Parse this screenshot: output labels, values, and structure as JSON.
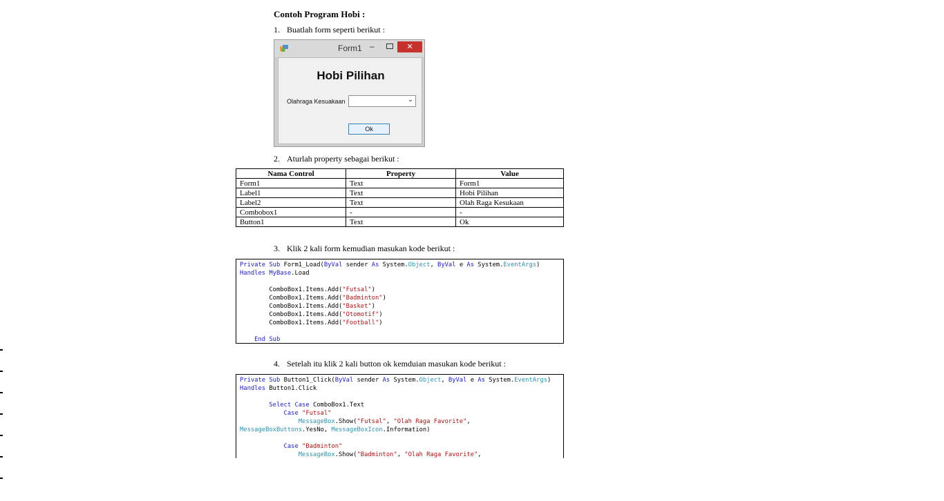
{
  "title": "Contoh Program Hobi :",
  "steps": [
    {
      "num": "1.",
      "text": "Buatlah form seperti berikut :"
    },
    {
      "num": "2.",
      "text": "Aturlah property sebagai berikut :"
    },
    {
      "num": "3.",
      "text": "Klik 2 kali form kemudian masukan kode berikut :"
    },
    {
      "num": "4.",
      "text": "Setelah itu klik 2 kali button ok kemduian masukan kode berikut :"
    }
  ],
  "form": {
    "title": "Form1",
    "minimize": "–",
    "close": "✕",
    "heading": "Hobi Pilihan",
    "label": "Olahraga Kesuakaan",
    "ok": "Ok",
    "icon": "app-window-icon",
    "combo_icon": "chevron-down-icon"
  },
  "table": {
    "headers": [
      "Nama Control",
      "Property",
      "Value"
    ],
    "rows": [
      [
        "Form1",
        "Text",
        "Form1"
      ],
      [
        "Label1",
        "Text",
        "Hobi Pilihan"
      ],
      [
        "Label2",
        "Text",
        "Olah Raga Kesukaan"
      ],
      [
        "Combobox1",
        "-",
        "-"
      ],
      [
        "Button1",
        "Text",
        "Ok"
      ]
    ]
  },
  "code1": [
    [
      [
        "kw",
        "Private Sub "
      ],
      [
        "txt",
        "Form1_Load("
      ],
      [
        "kw",
        "ByVal "
      ],
      [
        "txt",
        "sender "
      ],
      [
        "kw",
        "As "
      ],
      [
        "txt",
        "System."
      ],
      [
        "ty",
        "Object"
      ],
      [
        "txt",
        ", "
      ],
      [
        "kw",
        "ByVal "
      ],
      [
        "txt",
        "e "
      ],
      [
        "kw",
        "As "
      ],
      [
        "txt",
        "System."
      ],
      [
        "ty",
        "EventArgs"
      ],
      [
        "txt",
        ")"
      ]
    ],
    [
      [
        "kw",
        "Handles "
      ],
      [
        "kw",
        "MyBase"
      ],
      [
        "txt",
        ".Load"
      ]
    ],
    [],
    [
      [
        "txt",
        "        ComboBox1.Items.Add("
      ],
      [
        "st",
        "\"Futsal\""
      ],
      [
        "txt",
        ")"
      ]
    ],
    [
      [
        "txt",
        "        ComboBox1.Items.Add("
      ],
      [
        "st",
        "\"Badminton\""
      ],
      [
        "txt",
        ")"
      ]
    ],
    [
      [
        "txt",
        "        ComboBox1.Items.Add("
      ],
      [
        "st",
        "\"Basket\""
      ],
      [
        "txt",
        ")"
      ]
    ],
    [
      [
        "txt",
        "        ComboBox1.Items.Add("
      ],
      [
        "st",
        "\"Otomotif\""
      ],
      [
        "txt",
        ")"
      ]
    ],
    [
      [
        "txt",
        "        ComboBox1.Items.Add("
      ],
      [
        "st",
        "\"Football\""
      ],
      [
        "txt",
        ")"
      ]
    ],
    [],
    [
      [
        "kw",
        "    End Sub"
      ]
    ]
  ],
  "code2": [
    [
      [
        "kw",
        "Private Sub "
      ],
      [
        "txt",
        "Button1_Click("
      ],
      [
        "kw",
        "ByVal "
      ],
      [
        "txt",
        "sender "
      ],
      [
        "kw",
        "As "
      ],
      [
        "txt",
        "System."
      ],
      [
        "ty",
        "Object"
      ],
      [
        "txt",
        ", "
      ],
      [
        "kw",
        "ByVal "
      ],
      [
        "txt",
        "e "
      ],
      [
        "kw",
        "As "
      ],
      [
        "txt",
        "System."
      ],
      [
        "ty",
        "EventArgs"
      ],
      [
        "txt",
        ")"
      ]
    ],
    [
      [
        "kw",
        "Handles "
      ],
      [
        "txt",
        "Button1.Click"
      ]
    ],
    [],
    [
      [
        "kw",
        "        Select Case "
      ],
      [
        "txt",
        "ComboBox1.Text"
      ]
    ],
    [
      [
        "kw",
        "            Case "
      ],
      [
        "st",
        "\"Futsal\""
      ]
    ],
    [
      [
        "ty",
        "                MessageBox"
      ],
      [
        "txt",
        ".Show("
      ],
      [
        "st",
        "\"Futsal\""
      ],
      [
        "txt",
        ", "
      ],
      [
        "st",
        "\"Olah Raga Favorite\""
      ],
      [
        "txt",
        ","
      ]
    ],
    [
      [
        "ty",
        "MessageBoxButtons"
      ],
      [
        "txt",
        ".YesNo, "
      ],
      [
        "ty",
        "MessageBoxIcon"
      ],
      [
        "txt",
        ".Information)"
      ]
    ],
    [],
    [
      [
        "kw",
        "            Case "
      ],
      [
        "st",
        "\"Badminton\""
      ]
    ],
    [
      [
        "ty",
        "                MessageBox"
      ],
      [
        "txt",
        ".Show("
      ],
      [
        "st",
        "\"Badminton\""
      ],
      [
        "txt",
        ", "
      ],
      [
        "st",
        "\"Olah Raga Favorite\""
      ],
      [
        "txt",
        ","
      ]
    ]
  ]
}
